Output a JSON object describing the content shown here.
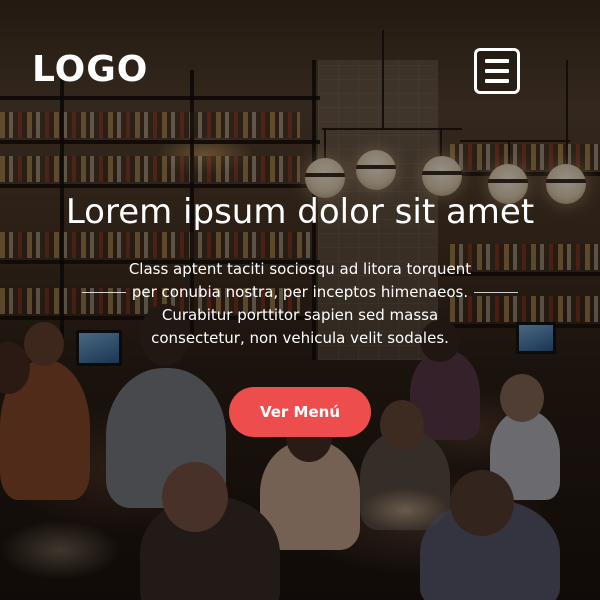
{
  "header": {
    "logo_text": "LOGO",
    "menu_icon": "hamburger-menu-icon"
  },
  "hero": {
    "headline": "Lorem ipsum dolor sit amet",
    "subtext_lines": [
      "Class aptent taciti sociosqu ad litora torquent",
      "per conubia nostra, per inceptos himenaeos.",
      "Curabitur porttitor sapien sed massa",
      "consectetur, non vehicula velit sodales."
    ],
    "cta_label": "Ver Menú"
  },
  "colors": {
    "cta_background": "#ee4d4d",
    "text": "#ffffff",
    "overlay": "rgba(0,0,0,0.42)"
  }
}
